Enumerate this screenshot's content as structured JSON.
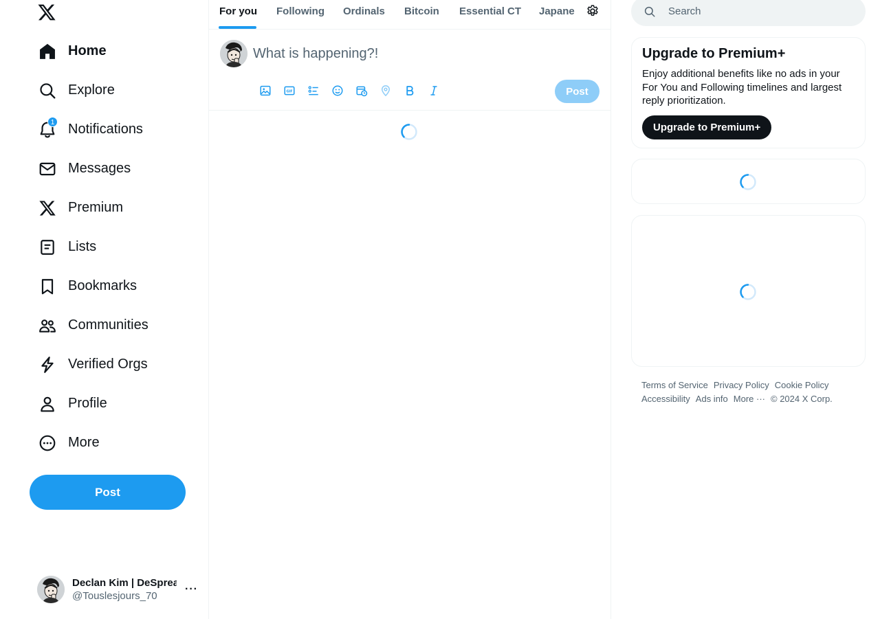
{
  "sidebar": {
    "logo": "x-logo-icon",
    "items": [
      {
        "label": "Home",
        "icon": "home-icon",
        "active": true
      },
      {
        "label": "Explore",
        "icon": "search-icon"
      },
      {
        "label": "Notifications",
        "icon": "bell-icon",
        "badge": "1"
      },
      {
        "label": "Messages",
        "icon": "envelope-icon"
      },
      {
        "label": "Premium",
        "icon": "x-logo-icon"
      },
      {
        "label": "Lists",
        "icon": "list-icon"
      },
      {
        "label": "Bookmarks",
        "icon": "bookmark-icon"
      },
      {
        "label": "Communities",
        "icon": "people-icon"
      },
      {
        "label": "Verified Orgs",
        "icon": "lightning-icon"
      },
      {
        "label": "Profile",
        "icon": "person-icon"
      },
      {
        "label": "More",
        "icon": "more-circle-icon"
      }
    ],
    "post_label": "Post",
    "account": {
      "name": "Declan Kim | DeSpread",
      "handle": "@Touslesjours_70",
      "more": "···"
    }
  },
  "main": {
    "tabs": [
      {
        "label": "For you",
        "active": true
      },
      {
        "label": "Following"
      },
      {
        "label": "Ordinals"
      },
      {
        "label": "Bitcoin"
      },
      {
        "label": "Essential CT"
      },
      {
        "label": "Japane"
      }
    ],
    "compose": {
      "placeholder": "What is happening?!",
      "tools": [
        "image-icon",
        "gif-icon",
        "poll-icon",
        "emoji-icon",
        "schedule-icon",
        "location-icon",
        "bold-icon",
        "italic-icon"
      ],
      "post_label": "Post"
    }
  },
  "right": {
    "search": {
      "placeholder": "Search"
    },
    "premium": {
      "title": "Upgrade to Premium+",
      "desc": "Enjoy additional benefits like no ads in your For You and Following timelines and largest reply prioritization.",
      "button": "Upgrade to Premium+"
    },
    "footer": {
      "terms": "Terms of Service",
      "privacy": "Privacy Policy",
      "cookie": "Cookie Policy",
      "accessibility": "Accessibility",
      "ads": "Ads info",
      "more": "More ···",
      "copyright": "© 2024 X Corp."
    }
  },
  "colors": {
    "accent": "#1d9bf0",
    "text": "#0f1419",
    "muted": "#536471",
    "border": "#eff3f4"
  }
}
